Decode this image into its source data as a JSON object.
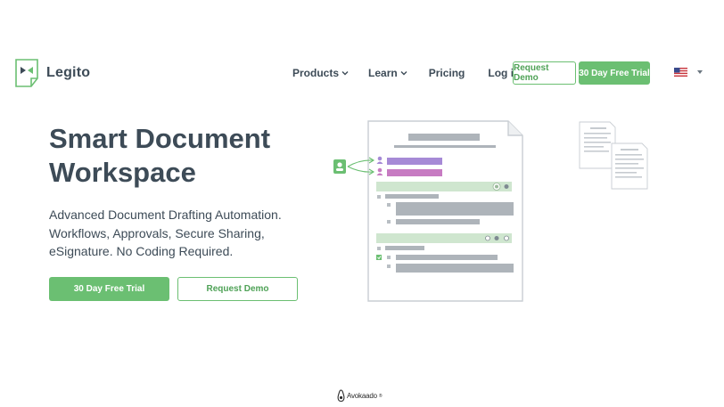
{
  "brand": {
    "name": "Legito",
    "accent": "#6bbf72"
  },
  "nav": {
    "items": [
      {
        "label": "Products",
        "has_dropdown": true
      },
      {
        "label": "Learn",
        "has_dropdown": true
      },
      {
        "label": "Pricing",
        "has_dropdown": false
      },
      {
        "label": "Log in",
        "has_dropdown": false
      }
    ],
    "request_demo": "Request Demo",
    "free_trial": "30 Day Free Trial",
    "language_icon": "us-flag-icon"
  },
  "hero": {
    "title_line1": "Smart Document",
    "title_line2": "Workspace",
    "subtitle_line1": "Advanced Document Drafting Automation.",
    "subtitle_line2": "Workflows, Approvals, Secure Sharing,",
    "subtitle_line3": "eSignature. No Coding Required.",
    "cta_primary": "30 Day Free Trial",
    "cta_secondary": "Request Demo"
  },
  "partner": {
    "name": "Avokaado",
    "mark": "®"
  }
}
